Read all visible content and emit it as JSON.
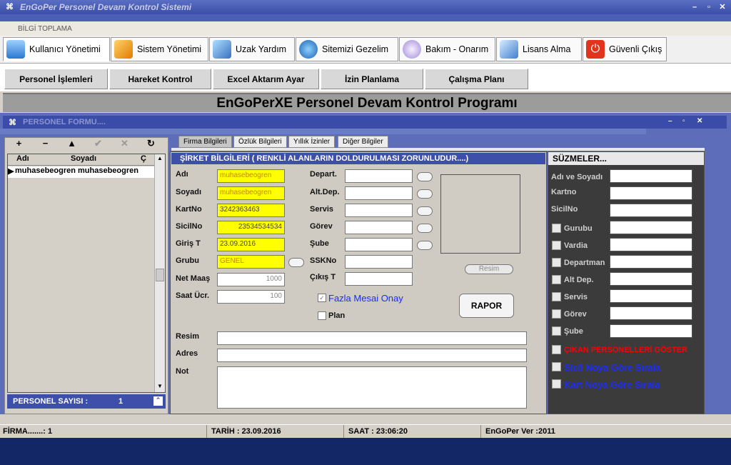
{
  "window": {
    "title": "EnGoPer Personel Devam Kontrol Sistemi",
    "menu_label": "BİLGİ TOPLAMA"
  },
  "ribbon": {
    "tabs": [
      {
        "label": "Kullanıcı Yönetimi",
        "icon": "flask-icon"
      },
      {
        "label": "Sistem Yönetimi",
        "icon": "pencil-icon"
      },
      {
        "label": "Uzak Yardım",
        "icon": "book-icon"
      },
      {
        "label": "Sitemizi Gezelim",
        "icon": "globe-icon"
      },
      {
        "label": "Bakım - Onarım",
        "icon": "lightbulb-icon"
      },
      {
        "label": "Lisans Alma",
        "icon": "document-icon"
      },
      {
        "label": "Güvenli Çıkış",
        "icon": "power-icon"
      }
    ]
  },
  "subbar": [
    "Personel İşlemleri",
    "Hareket Kontrol",
    "Excel Aktarım Ayar",
    "İzin Planlama",
    "Çalışma Planı"
  ],
  "banner": "EnGoPerXE Personel Devam Kontrol Programı",
  "form": {
    "title": "PERSONEL FORMU....",
    "nav": [
      "+",
      "−",
      "▲",
      "✔",
      "✕",
      "↻"
    ],
    "grid": {
      "headers": [
        "Adı",
        "Soyadı",
        "Ç"
      ],
      "rows": [
        [
          "muhasebeogren",
          "muhasebeogren"
        ]
      ]
    },
    "count_label": "PERSONEL SAYISI  :",
    "count_value": "1",
    "tabs": [
      "Firma Bilgileri",
      "Özlük Bilgileri",
      "Yıllık İzinler",
      "Diğer Bilgiler"
    ],
    "section_title": "ŞİRKET BİLGİLERİ    ( RENKLİ ALANLARIN DOLDURULMASI ZORUNLUDUR....)",
    "labels": {
      "adi": "Adı",
      "soyadi": "Soyadı",
      "kartno": "KartNo",
      "sicilno": "SicilNo",
      "giris": "Giriş T",
      "grubu": "Grubu",
      "netmaas": "Net Maaş",
      "saatucr": "Saat Ücr.",
      "depart": "Depart.",
      "altdep": "Alt.Dep.",
      "servis": "Servis",
      "gorev": "Görev",
      "sube": "Şube",
      "sskno": "SSKNo",
      "cikis": "Çıkış T",
      "resim": "Resim",
      "adres": "Adres",
      "not": "Not"
    },
    "values": {
      "adi": "muhasebeogren",
      "soyadi": "muhasebeogren",
      "kartno": "3242363463",
      "sicilno": "23534534534",
      "giris": "23.09.2016",
      "grubu": "GENEL",
      "netmaas": "1000",
      "saatucr": "100"
    },
    "fazla_mesai": "Fazla Mesai Onay",
    "plan": "Plan",
    "resim_button": "Resim",
    "rapor_button": "RAPOR",
    "filters_title": "SÜZMELER...",
    "filters": [
      "Adı ve Soyadı",
      "Kartno",
      "SicilNo",
      "Gurubu",
      "Vardia",
      "Departman",
      "Alt Dep.",
      "Servis",
      "Görev",
      "Şube"
    ],
    "filter_options": [
      {
        "label": "ÇIKAN PERSONELLERİ GÖSTER",
        "color": "#ff0000"
      },
      {
        "label": "Sicil Noya Göre Sırala",
        "color": "#1a2cff"
      },
      {
        "label": "Kart Noya Göre Sırala",
        "color": "#1a2cff"
      }
    ]
  },
  "status": {
    "firma": "FİRMA.......: 1",
    "tarih": "TARİH  : 23.09.2016",
    "saat": "SAAT  : 23:06:20",
    "version": "EnGoPer Ver :2011"
  }
}
